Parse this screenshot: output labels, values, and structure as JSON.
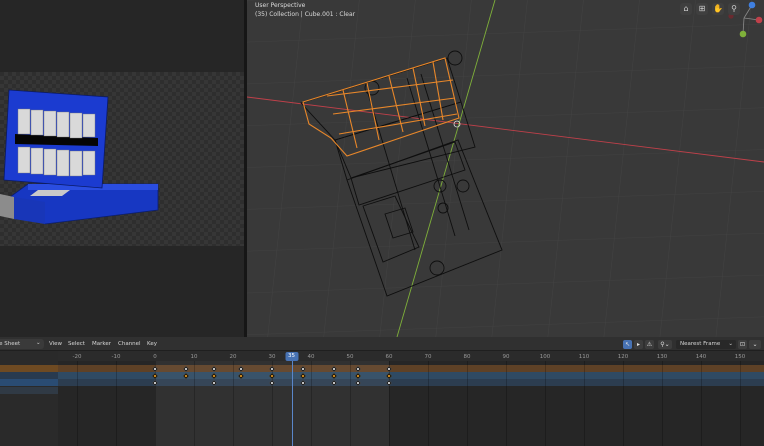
{
  "viewport": {
    "view_name": "User Perspective",
    "context_line": "(35) Collection | Cube.001 : Clear",
    "tools": [
      {
        "icon": "camera-icon",
        "glyph": "⌂"
      },
      {
        "icon": "grid-icon",
        "glyph": "⊞"
      },
      {
        "icon": "hand-icon",
        "glyph": "✋"
      },
      {
        "icon": "zoom-icon",
        "glyph": "⚲"
      }
    ]
  },
  "dopesheet": {
    "editor_type": "Dope Sheet",
    "menus": [
      "View",
      "Select",
      "Marker",
      "Channel",
      "Key"
    ],
    "snap_mode": "Nearest Frame",
    "current_frame": "35",
    "ruler_labels": [
      "-20",
      "-10",
      "0",
      "10",
      "20",
      "30",
      "40",
      "50",
      "60",
      "70",
      "80",
      "90",
      "100",
      "110",
      "120",
      "130",
      "140",
      "150"
    ],
    "ruler_frames": [
      -20,
      -10,
      0,
      10,
      20,
      30,
      40,
      50,
      60,
      70,
      80,
      90,
      100,
      110,
      120,
      130,
      140,
      150
    ],
    "keyframes": {
      "summary_row": [
        0,
        15,
        30,
        38,
        46,
        52,
        60
      ],
      "object_row": [
        0,
        8,
        15,
        22,
        30,
        38,
        46,
        52,
        60
      ]
    },
    "frame_range": [
      0,
      60
    ]
  },
  "colors": {
    "selection_orange": "#e8872a",
    "x_axis": "#c0404a",
    "y_axis": "#7fb03a",
    "playhead": "#4772b3",
    "action_row": "#5e4126",
    "object_row": "#2f4a63",
    "channel_orange": "#6e4a22",
    "channel_blue": "#2a4c73",
    "keyframe_selected": "#f0a020",
    "keyframe_unselected": "#e8e8e8"
  }
}
